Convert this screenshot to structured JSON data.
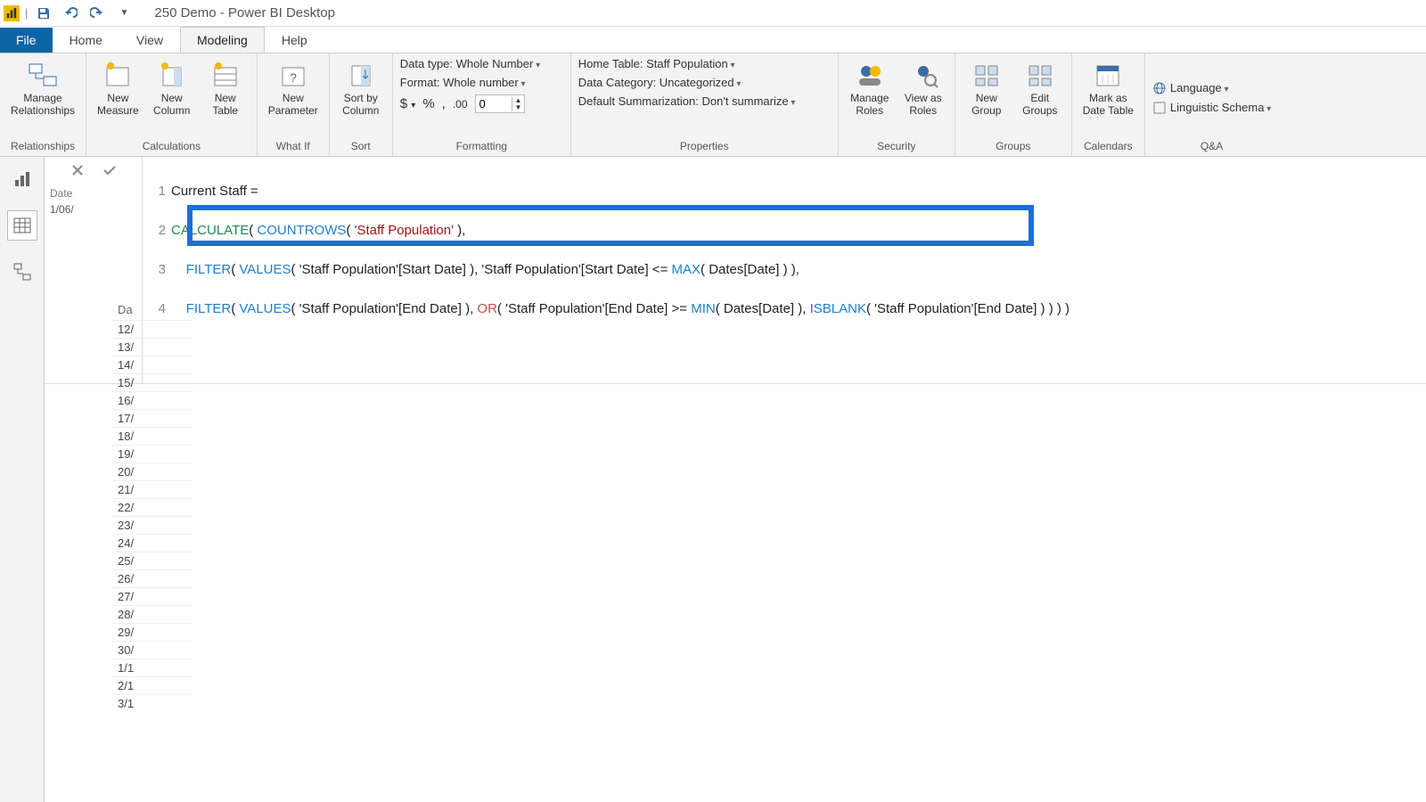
{
  "title": "250 Demo - Power BI Desktop",
  "tabs": {
    "file": "File",
    "home": "Home",
    "view": "View",
    "modeling": "Modeling",
    "help": "Help"
  },
  "ribbon": {
    "relationships": {
      "label": "Relationships",
      "manage": "Manage\nRelationships"
    },
    "calculations": {
      "label": "Calculations",
      "measure": "New\nMeasure",
      "column": "New\nColumn",
      "table": "New\nTable"
    },
    "whatif": {
      "label": "What If",
      "param": "New\nParameter"
    },
    "sort": {
      "label": "Sort",
      "sortby": "Sort by\nColumn"
    },
    "formatting": {
      "label": "Formatting",
      "datatype": "Data type: Whole Number",
      "format": "Format: Whole number",
      "decimals": "0"
    },
    "properties": {
      "label": "Properties",
      "hometable": "Home Table: Staff Population",
      "category": "Data Category: Uncategorized",
      "summ": "Default Summarization: Don't summarize"
    },
    "security": {
      "label": "Security",
      "manage": "Manage\nRoles",
      "view": "View as\nRoles"
    },
    "groups": {
      "label": "Groups",
      "new": "New\nGroup",
      "edit": "Edit\nGroups"
    },
    "calendars": {
      "label": "Calendars",
      "mark": "Mark as\nDate Table"
    },
    "qna": {
      "label": "Q&A",
      "lang": "Language",
      "ling": "Linguistic Schema"
    }
  },
  "formula_peek": {
    "header": "Date",
    "value": "1/06/"
  },
  "formula": {
    "line1_label": "Current Staff =",
    "line2_calc": "CALCULATE",
    "line2_count": "COUNTROWS",
    "line2_table": "'Staff Population'",
    "line3_filter": "FILTER",
    "line3_values": "VALUES",
    "line3_col": "'Staff Population'[Start Date]",
    "line3_col2": "'Staff Population'[Start Date]",
    "line3_max": "MAX",
    "line3_dates": "Dates[Date]",
    "line4_filter": "FILTER",
    "line4_values": "VALUES",
    "line4_col": "'Staff Population'[End Date]",
    "line4_or": "OR",
    "line4_col2": "'Staff Population'[End Date]",
    "line4_min": "MIN",
    "line4_dates": "Dates[Date]",
    "line4_isblank": "ISBLANK",
    "line4_col3": "'Staff Population'[End Date]"
  },
  "date_column": {
    "header": "Da",
    "rows": [
      "12/",
      "13/",
      "14/",
      "15/",
      "16/",
      "17/",
      "18/",
      "19/",
      "20/",
      "21/",
      "22/",
      "23/",
      "24/",
      "25/",
      "26/",
      "27/",
      "28/",
      "29/",
      "30/",
      "1/1",
      "2/1",
      "3/1"
    ]
  }
}
